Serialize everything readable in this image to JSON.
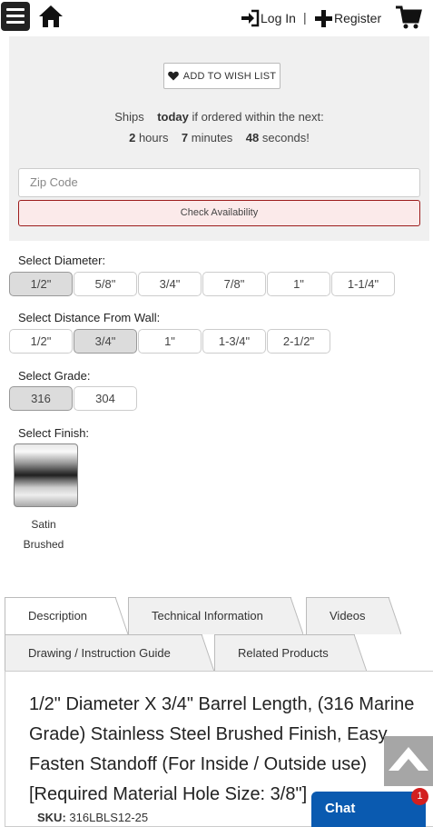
{
  "header": {
    "login_label": "Log In",
    "separator": "|",
    "register_label": "Register"
  },
  "panel": {
    "wish_label": "ADD TO WISH LIST",
    "ships_prefix": "Ships",
    "ships_day": "today",
    "ships_suffix": "if ordered within the next:",
    "hours_value": "2",
    "hours_label": "hours",
    "minutes_value": "7",
    "minutes_label": "minutes",
    "seconds_value": "48",
    "seconds_label": "seconds!",
    "zip_placeholder": "Zip Code",
    "check_label": "Check Availability"
  },
  "options": {
    "diameter": {
      "label": "Select Diameter:",
      "items": [
        "1/2\"",
        "5/8\"",
        "3/4\"",
        "7/8\"",
        "1\"",
        "1-1/4\""
      ],
      "selected": "1/2\""
    },
    "distance": {
      "label": "Select Distance From Wall:",
      "items": [
        "1/2\"",
        "3/4\"",
        "1\"",
        "1-3/4\"",
        "2-1/2\""
      ],
      "selected": "3/4\""
    },
    "grade": {
      "label": "Select Grade:",
      "items": [
        "316",
        "304"
      ],
      "selected": "316"
    },
    "finish": {
      "label": "Select Finish:",
      "line1": "Satin",
      "line2": "Brushed"
    }
  },
  "tabs": [
    {
      "label": "Description"
    },
    {
      "label": "Technical Information"
    },
    {
      "label": "Videos"
    },
    {
      "label": "Drawing / Instruction Guide"
    },
    {
      "label": "Related Products"
    }
  ],
  "product": {
    "title": "1/2\" Diameter X 3/4\" Barrel Length, (316 Marine Grade) Stainless Steel Brushed Finish, Easy Fasten Standoff (For Inside / Outside use) [Required Material Hole Size: 3/8\"]",
    "sku_label": "SKU:",
    "sku_value": "316LBLS12-25"
  },
  "chat": {
    "label": "Chat",
    "badge": "1"
  },
  "colors": {
    "accent_red": "#9c1c1c",
    "chat_blue": "#0a5ab0",
    "badge_red": "#d21f1f",
    "panel_grey": "#f0f0f0"
  }
}
